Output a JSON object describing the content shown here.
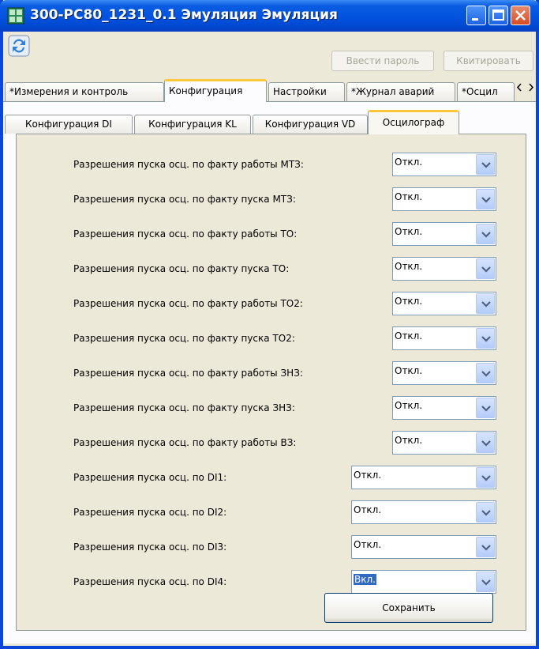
{
  "window": {
    "title": "300-РС80_1231_0.1 Эмуляция Эмуляция",
    "icon": "grid-app-icon"
  },
  "toolbar": {
    "refresh_icon": "refresh-icon",
    "password_button": "Ввести пароль",
    "acknowledge_button": "Квитировать"
  },
  "tabs": [
    {
      "label": "*Измерения и контроль"
    },
    {
      "label": "Конфигурация"
    },
    {
      "label": "Настройки"
    },
    {
      "label": "*Журнал аварий"
    },
    {
      "label": "*Осцил"
    }
  ],
  "subtabs": [
    {
      "label": "Конфигурация DI"
    },
    {
      "label": "Конфигурация KL"
    },
    {
      "label": "Конфигурация VD"
    },
    {
      "label": "Осцилограф"
    }
  ],
  "settings": [
    {
      "label": "Разрешения пуска осц. по факту работы МТЗ:",
      "value": "Откл."
    },
    {
      "label": "Разрешения пуска осц. по факту пуска МТЗ:",
      "value": "Откл."
    },
    {
      "label": "Разрешения пуска осц. по факту работы ТО:",
      "value": "Откл."
    },
    {
      "label": "Разрешения пуска осц. по факту пуска ТО:",
      "value": "Откл."
    },
    {
      "label": "Разрешения пуска осц. по факту работы ТО2:",
      "value": "Откл."
    },
    {
      "label": "Разрешения пуска осц. по факту пуска ТО2:",
      "value": "Откл."
    },
    {
      "label": "Разрешения пуска осц. по факту работы ЗНЗ:",
      "value": "Откл."
    },
    {
      "label": "Разрешения пуска осц. по факту пуска ЗНЗ:",
      "value": "Откл."
    },
    {
      "label": "Разрешения пуска осц. по факту работы ВЗ:",
      "value": "Откл."
    },
    {
      "label": "Разрешения пуска осц. по DI1:",
      "value": "Откл."
    },
    {
      "label": "Разрешения пуска осц. по DI2:",
      "value": "Откл."
    },
    {
      "label": "Разрешения пуска осц. по DI3:",
      "value": "Откл."
    },
    {
      "label": "Разрешения пуска осц. по DI4:",
      "value": "Вкл."
    }
  ],
  "save_button": "Сохранить",
  "colors": {
    "titlebar": "#0254e0",
    "frame": "#ece9d8",
    "tab_highlight": "#ffc83c",
    "selection": "#316ac5"
  }
}
